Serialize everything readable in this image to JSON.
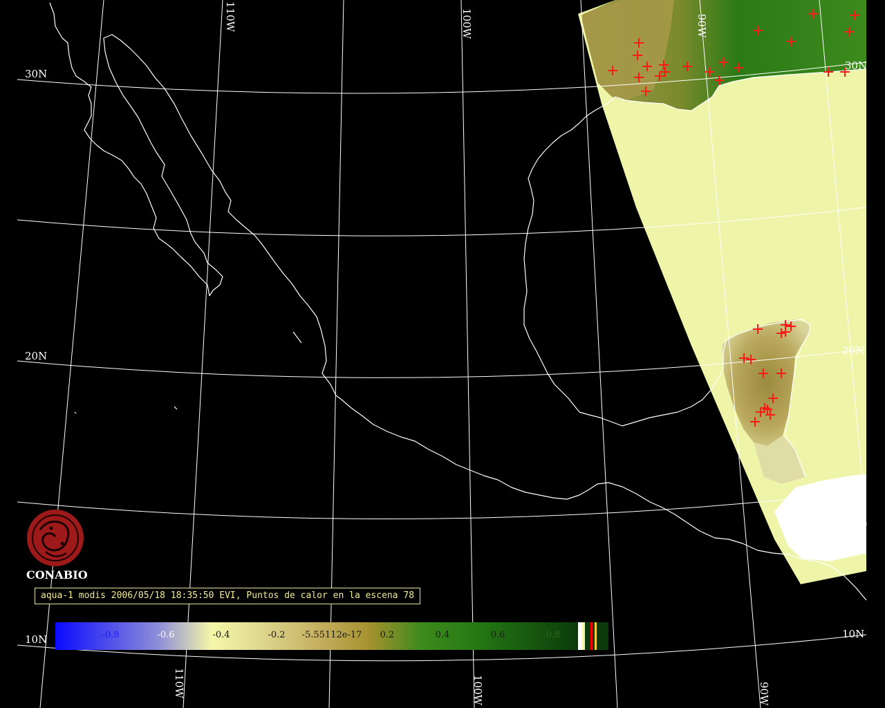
{
  "map": {
    "graticule_labels": [
      {
        "id": "lat-30n",
        "text": "30N"
      },
      {
        "id": "lat-20n",
        "text": "20N"
      },
      {
        "id": "lat-10n",
        "text": "10N"
      },
      {
        "id": "lat-20n-east",
        "text": "20N"
      },
      {
        "id": "lat-10n-east",
        "text": "10N"
      },
      {
        "id": "lat-30n-east",
        "text": "30N"
      },
      {
        "id": "lon-110w-top",
        "text": "110W"
      },
      {
        "id": "lon-100w-top",
        "text": "100W"
      },
      {
        "id": "lon-90w-top",
        "text": "90W"
      },
      {
        "id": "lon-110w-bottom",
        "text": "110W"
      },
      {
        "id": "lon-100w-bottom",
        "text": "100W"
      },
      {
        "id": "lon-90w-bottom",
        "text": "90W"
      }
    ],
    "hotspot_color": "#ff1a1a",
    "coast_color": "#ffffff",
    "swath_base_color": "#eef5a8"
  },
  "logo": {
    "name": "CONABIO",
    "color": "#9e1a1a"
  },
  "caption": {
    "text": "aqua-1 modis 2006/05/18 18:35:50 EVI, Puntos de calor en la escena 78"
  },
  "colorbar": {
    "ticks": [
      "-0.8",
      "-0.6",
      "-0.4",
      "-0.2",
      "-5.55112e-17",
      "0.2",
      "0.4",
      "0.6",
      "0.8"
    ],
    "stops": [
      {
        "value": -1.0,
        "color": "#0a0aff"
      },
      {
        "value": -0.6,
        "color": "#9090d8"
      },
      {
        "value": -0.4,
        "color": "#f6f7a8"
      },
      {
        "value": -0.2,
        "color": "#dcd58a"
      },
      {
        "value": 0.0,
        "color": "#c6b062"
      },
      {
        "value": 0.2,
        "color": "#a6922e"
      },
      {
        "value": 0.4,
        "color": "#3e8a1c"
      },
      {
        "value": 0.6,
        "color": "#267a14"
      },
      {
        "value": 1.0,
        "color": "#0b3b0b"
      }
    ],
    "extra_swatches": [
      "#ffffff",
      "#eef5a8",
      "#ff0000",
      "#ffd23c"
    ]
  }
}
